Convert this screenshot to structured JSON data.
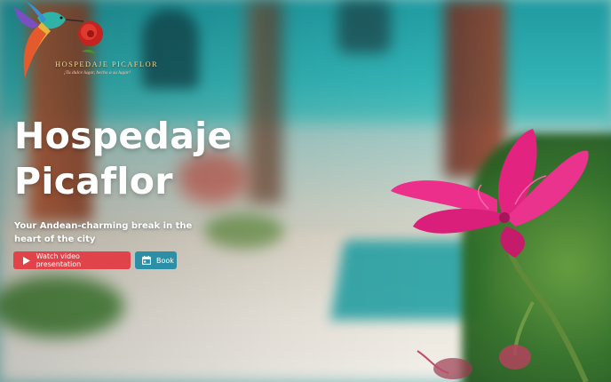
{
  "logo": {
    "name": "HOSPEDAJE PICAFLOR",
    "tagline": "¡Tu dulce lugar, hecho a su lugar!",
    "icon": "hummingbird-logo"
  },
  "hero": {
    "title_line1": "Hospedaje",
    "title_line2": "Picaflor",
    "subtitle": "Your Andean-charming break in the heart of the city"
  },
  "actions": {
    "video_label": "Watch video presentation",
    "video_icon": "play-icon",
    "book_label": "Book",
    "book_icon": "calendar-icon"
  },
  "colors": {
    "video_button": "#e0444a",
    "book_button": "#2d8fa6",
    "text": "#ffffff"
  }
}
